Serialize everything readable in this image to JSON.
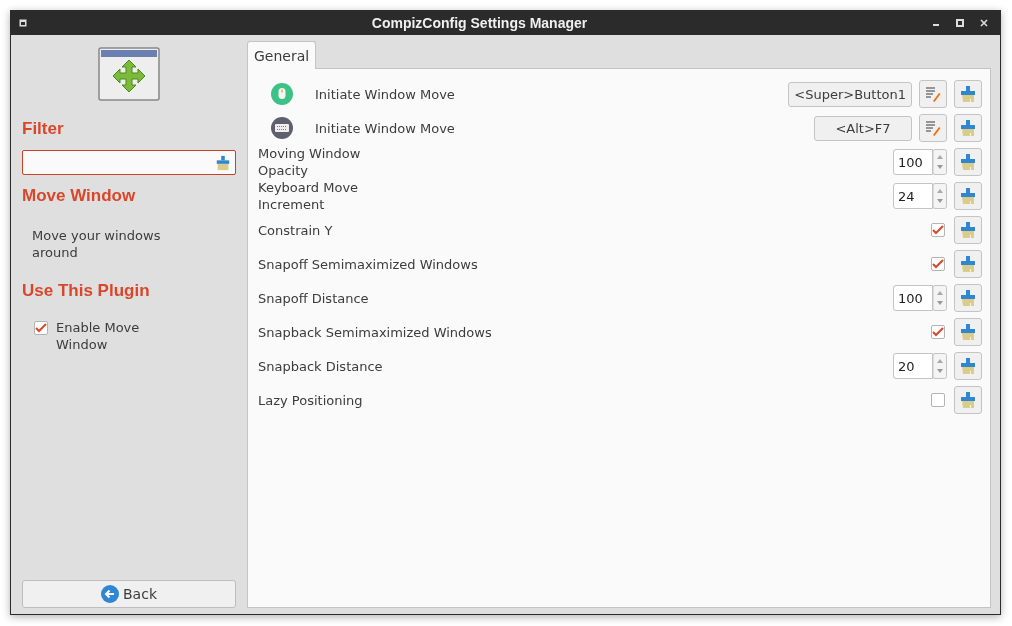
{
  "window": {
    "title": "CompizConfig Settings Manager"
  },
  "sidebar": {
    "filter_heading": "Filter",
    "plugin_heading": "Move Window",
    "plugin_description": "Move your windows around",
    "use_heading": "Use This Plugin",
    "enable": {
      "label": "Enable Move Window",
      "checked": true
    },
    "back_button": "Back"
  },
  "tabs": [
    {
      "label": "General",
      "selected": true
    }
  ],
  "settings": [
    {
      "kind": "mouse_binding",
      "label": "Initiate Window Move",
      "value": "<Super>Button1"
    },
    {
      "kind": "key_binding",
      "label": "Initiate Window Move",
      "value": "<Alt>F7"
    },
    {
      "kind": "spin",
      "label": "Moving Window Opacity",
      "value": "100"
    },
    {
      "kind": "spin",
      "label": "Keyboard Move Increment",
      "value": "24"
    },
    {
      "kind": "check",
      "label": "Constrain Y",
      "checked": true
    },
    {
      "kind": "check",
      "label": "Snapoff Semimaximized Windows",
      "checked": true
    },
    {
      "kind": "spin",
      "label": "Snapoff Distance",
      "value": "100"
    },
    {
      "kind": "check",
      "label": "Snapback Semimaximized Windows",
      "checked": true
    },
    {
      "kind": "spin",
      "label": "Snapback Distance",
      "value": "20"
    },
    {
      "kind": "check",
      "label": "Lazy Positioning",
      "checked": false
    }
  ]
}
